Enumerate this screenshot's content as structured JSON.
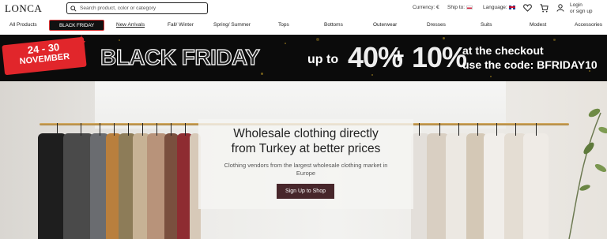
{
  "header": {
    "logo": "LONCA",
    "search_placeholder": "Search product, color or category",
    "currency": "Currency: €",
    "ship_to": "Ship to:",
    "language": "Language:",
    "login": "Login",
    "signup": "or sign up"
  },
  "nav": {
    "items": [
      "All Products",
      "BLACK FRIDAY",
      "New Arrivals",
      "Fall/ Winter",
      "Spring/ Summer",
      "Tops",
      "Bottoms",
      "Outerwear",
      "Dresses",
      "Suits",
      "Modest",
      "Accessories"
    ]
  },
  "banner": {
    "dates": "24 - 30",
    "month": "NOVEMBER",
    "title": "BLACK FRIDAY",
    "up_to": "up to",
    "discount1": "40%",
    "plus": "+",
    "discount2": "10%",
    "checkout_line1": "at the checkout",
    "checkout_line2": "use the code: BFRIDAY10"
  },
  "hero": {
    "title_line1": "Wholesale clothing directly",
    "title_line2": "from Turkey at better prices",
    "subtitle": "Clothing vendors from the largest wholesale clothing market in Europe",
    "cta": "Sign Up to Shop"
  },
  "colors": {
    "accent_red": "#e1262b",
    "cta_bg": "#47262b",
    "banner_bg": "#0b0b0b"
  }
}
